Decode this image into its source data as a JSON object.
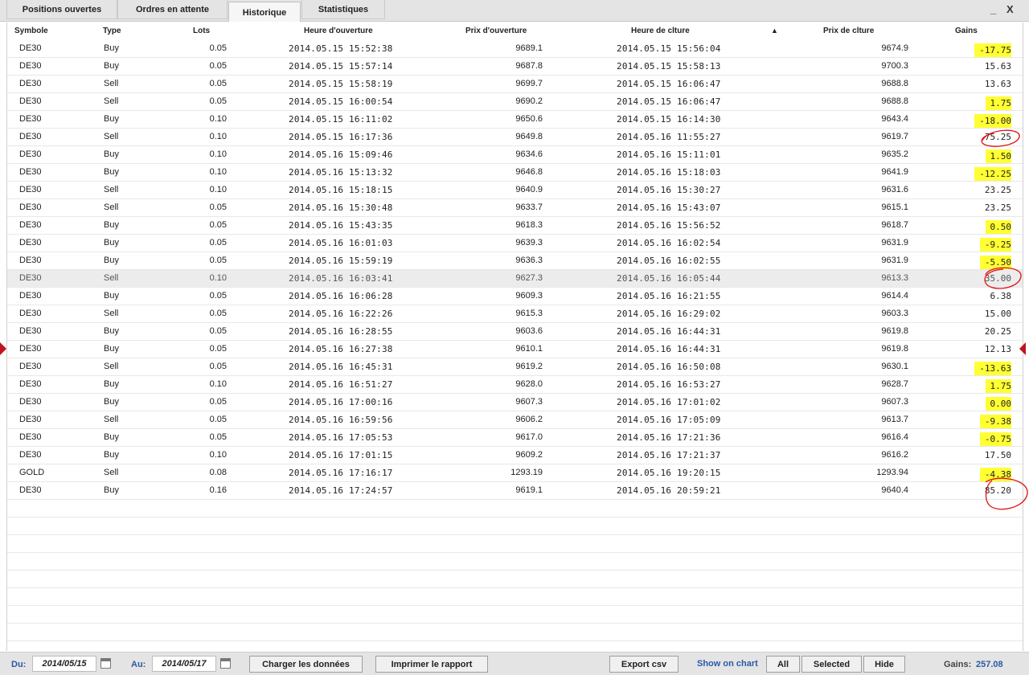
{
  "tabs": [
    {
      "label": "Positions ouvertes",
      "active": false
    },
    {
      "label": "Ordres en attente",
      "active": false
    },
    {
      "label": "Historique",
      "active": true
    },
    {
      "label": "Statistiques",
      "active": false
    }
  ],
  "window_controls": {
    "minimize": "_",
    "close": "X"
  },
  "columns": {
    "symbol": "Symbole",
    "type": "Type",
    "lots": "Lots",
    "open_time": "Heure d'ouverture",
    "open_price": "Prix d'ouverture",
    "close_time": "Heure de clture",
    "sort_indicator": "▲",
    "close_price": "Prix de clture",
    "gains": "Gains"
  },
  "rows": [
    {
      "sym": "DE30",
      "type": "Buy",
      "lots": "0.05",
      "open": "2014.05.15 15:52:38",
      "op": "9689.1",
      "close": "2014.05.15 15:56:04",
      "cp": "9674.9",
      "gain": "-17.75",
      "hl": true
    },
    {
      "sym": "DE30",
      "type": "Buy",
      "lots": "0.05",
      "open": "2014.05.15 15:57:14",
      "op": "9687.8",
      "close": "2014.05.15 15:58:13",
      "cp": "9700.3",
      "gain": "15.63",
      "hl": false
    },
    {
      "sym": "DE30",
      "type": "Sell",
      "lots": "0.05",
      "open": "2014.05.15 15:58:19",
      "op": "9699.7",
      "close": "2014.05.15 16:06:47",
      "cp": "9688.8",
      "gain": "13.63",
      "hl": false
    },
    {
      "sym": "DE30",
      "type": "Sell",
      "lots": "0.05",
      "open": "2014.05.15 16:00:54",
      "op": "9690.2",
      "close": "2014.05.15 16:06:47",
      "cp": "9688.8",
      "gain": "1.75",
      "hl": true
    },
    {
      "sym": "DE30",
      "type": "Buy",
      "lots": "0.10",
      "open": "2014.05.15 16:11:02",
      "op": "9650.6",
      "close": "2014.05.15 16:14:30",
      "cp": "9643.4",
      "gain": "-18.00",
      "hl": true
    },
    {
      "sym": "DE30",
      "type": "Sell",
      "lots": "0.10",
      "open": "2014.05.15 16:17:36",
      "op": "9649.8",
      "close": "2014.05.16 11:55:27",
      "cp": "9619.7",
      "gain": "75.25",
      "hl": false
    },
    {
      "sym": "DE30",
      "type": "Buy",
      "lots": "0.10",
      "open": "2014.05.16 15:09:46",
      "op": "9634.6",
      "close": "2014.05.16 15:11:01",
      "cp": "9635.2",
      "gain": "1.50",
      "hl": true
    },
    {
      "sym": "DE30",
      "type": "Buy",
      "lots": "0.10",
      "open": "2014.05.16 15:13:32",
      "op": "9646.8",
      "close": "2014.05.16 15:18:03",
      "cp": "9641.9",
      "gain": "-12.25",
      "hl": true
    },
    {
      "sym": "DE30",
      "type": "Sell",
      "lots": "0.10",
      "open": "2014.05.16 15:18:15",
      "op": "9640.9",
      "close": "2014.05.16 15:30:27",
      "cp": "9631.6",
      "gain": "23.25",
      "hl": false
    },
    {
      "sym": "DE30",
      "type": "Sell",
      "lots": "0.05",
      "open": "2014.05.16 15:30:48",
      "op": "9633.7",
      "close": "2014.05.16 15:43:07",
      "cp": "9615.1",
      "gain": "23.25",
      "hl": false
    },
    {
      "sym": "DE30",
      "type": "Buy",
      "lots": "0.05",
      "open": "2014.05.16 15:43:35",
      "op": "9618.3",
      "close": "2014.05.16 15:56:52",
      "cp": "9618.7",
      "gain": "0.50",
      "hl": true
    },
    {
      "sym": "DE30",
      "type": "Buy",
      "lots": "0.05",
      "open": "2014.05.16 16:01:03",
      "op": "9639.3",
      "close": "2014.05.16 16:02:54",
      "cp": "9631.9",
      "gain": "-9.25",
      "hl": true
    },
    {
      "sym": "DE30",
      "type": "Buy",
      "lots": "0.05",
      "open": "2014.05.16 15:59:19",
      "op": "9636.3",
      "close": "2014.05.16 16:02:55",
      "cp": "9631.9",
      "gain": "-5.50",
      "hl": true
    },
    {
      "sym": "DE30",
      "type": "Sell",
      "lots": "0.10",
      "open": "2014.05.16 16:03:41",
      "op": "9627.3",
      "close": "2014.05.16 16:05:44",
      "cp": "9613.3",
      "gain": "35.00",
      "hl": false,
      "selected": true
    },
    {
      "sym": "DE30",
      "type": "Buy",
      "lots": "0.05",
      "open": "2014.05.16 16:06:28",
      "op": "9609.3",
      "close": "2014.05.16 16:21:55",
      "cp": "9614.4",
      "gain": "6.38",
      "hl": false
    },
    {
      "sym": "DE30",
      "type": "Sell",
      "lots": "0.05",
      "open": "2014.05.16 16:22:26",
      "op": "9615.3",
      "close": "2014.05.16 16:29:02",
      "cp": "9603.3",
      "gain": "15.00",
      "hl": false
    },
    {
      "sym": "DE30",
      "type": "Buy",
      "lots": "0.05",
      "open": "2014.05.16 16:28:55",
      "op": "9603.6",
      "close": "2014.05.16 16:44:31",
      "cp": "9619.8",
      "gain": "20.25",
      "hl": false
    },
    {
      "sym": "DE30",
      "type": "Buy",
      "lots": "0.05",
      "open": "2014.05.16 16:27:38",
      "op": "9610.1",
      "close": "2014.05.16 16:44:31",
      "cp": "9619.8",
      "gain": "12.13",
      "hl": false
    },
    {
      "sym": "DE30",
      "type": "Sell",
      "lots": "0.05",
      "open": "2014.05.16 16:45:31",
      "op": "9619.2",
      "close": "2014.05.16 16:50:08",
      "cp": "9630.1",
      "gain": "-13.63",
      "hl": true
    },
    {
      "sym": "DE30",
      "type": "Buy",
      "lots": "0.10",
      "open": "2014.05.16 16:51:27",
      "op": "9628.0",
      "close": "2014.05.16 16:53:27",
      "cp": "9628.7",
      "gain": "1.75",
      "hl": true
    },
    {
      "sym": "DE30",
      "type": "Buy",
      "lots": "0.05",
      "open": "2014.05.16 17:00:16",
      "op": "9607.3",
      "close": "2014.05.16 17:01:02",
      "cp": "9607.3",
      "gain": "0.00",
      "hl": true
    },
    {
      "sym": "DE30",
      "type": "Sell",
      "lots": "0.05",
      "open": "2014.05.16 16:59:56",
      "op": "9606.2",
      "close": "2014.05.16 17:05:09",
      "cp": "9613.7",
      "gain": "-9.38",
      "hl": true
    },
    {
      "sym": "DE30",
      "type": "Buy",
      "lots": "0.05",
      "open": "2014.05.16 17:05:53",
      "op": "9617.0",
      "close": "2014.05.16 17:21:36",
      "cp": "9616.4",
      "gain": "-0.75",
      "hl": true
    },
    {
      "sym": "DE30",
      "type": "Buy",
      "lots": "0.10",
      "open": "2014.05.16 17:01:15",
      "op": "9609.2",
      "close": "2014.05.16 17:21:37",
      "cp": "9616.2",
      "gain": "17.50",
      "hl": false
    },
    {
      "sym": "GOLD",
      "type": "Sell",
      "lots": "0.08",
      "open": "2014.05.16 17:16:17",
      "op": "1293.19",
      "close": "2014.05.16 19:20:15",
      "cp": "1293.94",
      "gain": "-4.38",
      "hl": true
    },
    {
      "sym": "DE30",
      "type": "Buy",
      "lots": "0.16",
      "open": "2014.05.16 17:24:57",
      "op": "9619.1",
      "close": "2014.05.16 20:59:21",
      "cp": "9640.4",
      "gain": "85.20",
      "hl": false
    }
  ],
  "colors": {
    "highlight": "#ffff33",
    "annotation": "#e01010",
    "accent": "#2a5aa8",
    "marker": "#c0141e"
  },
  "footer": {
    "from_label": "Du:",
    "from_value": "2014/05/15",
    "to_label": "Au:",
    "to_value": "2014/05/17",
    "load_button": "Charger les données",
    "print_button": "Imprimer le rapport",
    "export_button": "Export csv",
    "show_on_chart_label": "Show on chart",
    "all_button": "All",
    "selected_button": "Selected",
    "hide_button": "Hide",
    "gains_label": "Gains:",
    "gains_value": "257.08"
  }
}
